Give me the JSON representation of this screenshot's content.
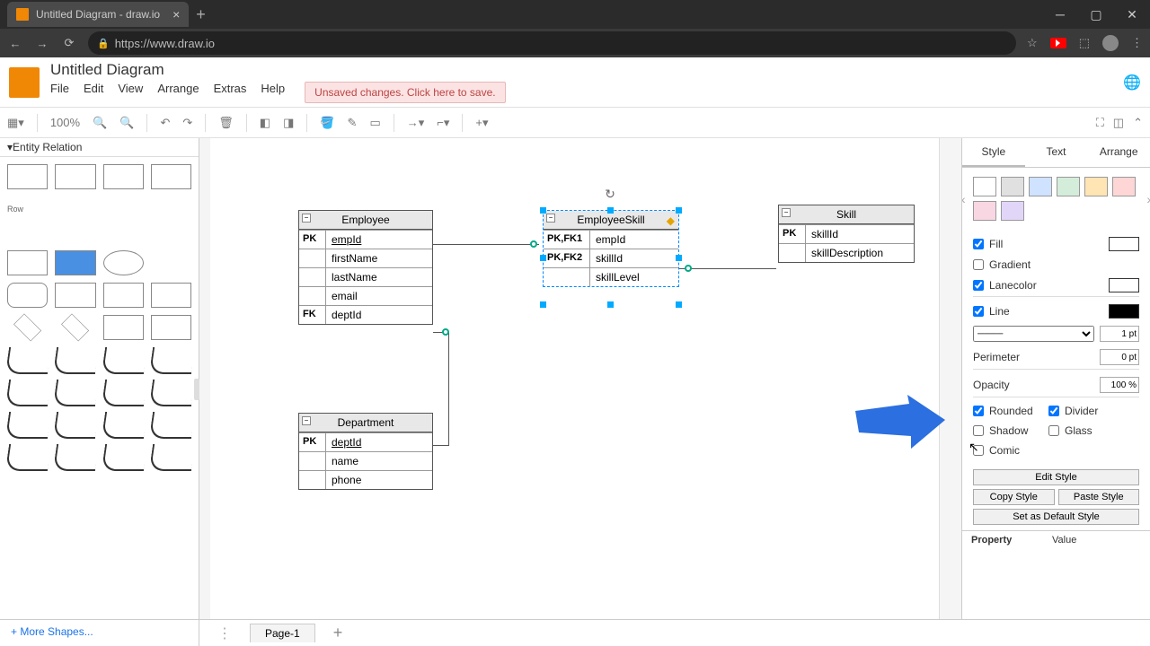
{
  "browser": {
    "tab_title": "Untitled Diagram - draw.io",
    "url": "https://www.draw.io"
  },
  "app": {
    "doc_title": "Untitled Diagram",
    "menu": [
      "File",
      "Edit",
      "View",
      "Arrange",
      "Extras",
      "Help"
    ],
    "warning": "Unsaved changes. Click here to save.",
    "zoom": "100%"
  },
  "sidebar": {
    "section": "Entity Relation",
    "row_label": "Row",
    "more_shapes": "+ More Shapes..."
  },
  "canvas": {
    "entities": {
      "employee": {
        "title": "Employee",
        "rows": [
          {
            "key": "PK",
            "val": "empId",
            "u": true
          },
          {
            "key": "",
            "val": "firstName"
          },
          {
            "key": "",
            "val": "lastName"
          },
          {
            "key": "",
            "val": "email"
          },
          {
            "key": "FK",
            "val": "deptId"
          }
        ]
      },
      "employeeskill": {
        "title": "EmployeeSkill",
        "rows": [
          {
            "key": "PK,FK1",
            "val": "empId"
          },
          {
            "key": "PK,FK2",
            "val": "skillId"
          },
          {
            "key": "",
            "val": "skillLevel"
          }
        ]
      },
      "skill": {
        "title": "Skill",
        "rows": [
          {
            "key": "PK",
            "val": "skillId"
          },
          {
            "key": "",
            "val": "skillDescription"
          }
        ]
      },
      "department": {
        "title": "Department",
        "rows": [
          {
            "key": "PK",
            "val": "deptId",
            "u": true
          },
          {
            "key": "",
            "val": "name"
          },
          {
            "key": "",
            "val": "phone"
          }
        ]
      }
    },
    "page_tab": "Page-1"
  },
  "rpanel": {
    "tabs": [
      "Style",
      "Text",
      "Arrange"
    ],
    "swatch_colors": [
      "#ffffff",
      "#e0e0e0",
      "#cfe2ff",
      "#d4edda",
      "#ffe5b4",
      "#ffd6d6",
      "#f8d7e3",
      "#e2d6f8"
    ],
    "fill": {
      "label": "Fill",
      "checked": true,
      "color": "#ffffff"
    },
    "gradient": {
      "label": "Gradient",
      "checked": false
    },
    "lanecolor": {
      "label": "Lanecolor",
      "checked": true,
      "color": "#ffffff"
    },
    "line": {
      "label": "Line",
      "checked": true,
      "color": "#000000",
      "width": "1 pt"
    },
    "perimeter": {
      "label": "Perimeter",
      "value": "0 pt"
    },
    "opacity": {
      "label": "Opacity",
      "value": "100 %"
    },
    "rounded": {
      "label": "Rounded",
      "checked": true
    },
    "divider": {
      "label": "Divider",
      "checked": true
    },
    "shadow": {
      "label": "Shadow",
      "checked": false
    },
    "glass": {
      "label": "Glass",
      "checked": false
    },
    "comic": {
      "label": "Comic",
      "checked": false
    },
    "edit_style": "Edit Style",
    "copy_style": "Copy Style",
    "paste_style": "Paste Style",
    "default_style": "Set as Default Style",
    "prop_hdr": "Property",
    "val_hdr": "Value"
  }
}
